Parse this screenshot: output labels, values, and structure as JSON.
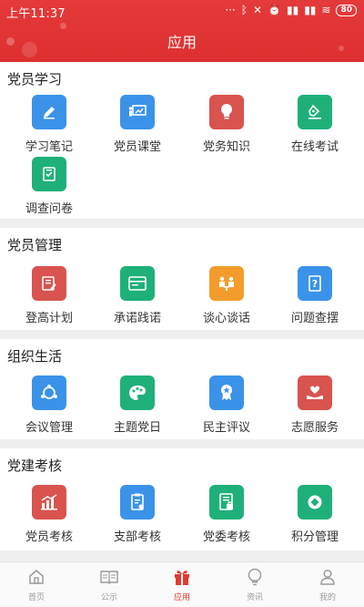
{
  "status": {
    "time": "上午11:37",
    "battery": "80"
  },
  "header": {
    "title": "应用"
  },
  "sections": [
    {
      "title": "党员学习",
      "items": [
        {
          "label": "学习笔记",
          "icon": "pencil-icon",
          "color": "#3a93e8"
        },
        {
          "label": "党员课堂",
          "icon": "classroom-icon",
          "color": "#3a93e8"
        },
        {
          "label": "党务知识",
          "icon": "lightbulb-icon",
          "color": "#d9534f"
        },
        {
          "label": "在线考试",
          "icon": "pen-exam-icon",
          "color": "#1fb07a"
        },
        {
          "label": "调查问卷",
          "icon": "survey-icon",
          "color": "#1fb07a"
        }
      ]
    },
    {
      "title": "党员管理",
      "items": [
        {
          "label": "登高计划",
          "icon": "plan-icon",
          "color": "#d9534f"
        },
        {
          "label": "承诺践诺",
          "icon": "card-icon",
          "color": "#1fb07a"
        },
        {
          "label": "谈心谈话",
          "icon": "talk-icon",
          "color": "#f39c2c"
        },
        {
          "label": "问题查摆",
          "icon": "question-icon",
          "color": "#3a93e8"
        }
      ]
    },
    {
      "title": "组织生活",
      "items": [
        {
          "label": "会议管理",
          "icon": "meeting-icon",
          "color": "#3a93e8"
        },
        {
          "label": "主题党日",
          "icon": "palette-icon",
          "color": "#1fb07a"
        },
        {
          "label": "民主评议",
          "icon": "medal-icon",
          "color": "#3a93e8"
        },
        {
          "label": "志愿服务",
          "icon": "heart-hand-icon",
          "color": "#d9534f"
        }
      ]
    },
    {
      "title": "党建考核",
      "items": [
        {
          "label": "党员考核",
          "icon": "bar-chart-icon",
          "color": "#d9534f"
        },
        {
          "label": "支部考核",
          "icon": "clipboard-icon",
          "color": "#3a93e8"
        },
        {
          "label": "党委考核",
          "icon": "doc-lock-icon",
          "color": "#1fb07a"
        },
        {
          "label": "积分管理",
          "icon": "coin-icon",
          "color": "#1fb07a"
        }
      ]
    }
  ],
  "nav": [
    {
      "label": "首页",
      "icon": "home-icon"
    },
    {
      "label": "公示",
      "icon": "book-icon"
    },
    {
      "label": "应用",
      "icon": "gift-icon",
      "active": true
    },
    {
      "label": "资讯",
      "icon": "bulb-outline-icon"
    },
    {
      "label": "我的",
      "icon": "user-icon"
    }
  ],
  "colors": {
    "accent": "#e03a30",
    "blue": "#3a93e8",
    "red": "#d9534f",
    "green": "#1fb07a",
    "orange": "#f39c2c"
  }
}
